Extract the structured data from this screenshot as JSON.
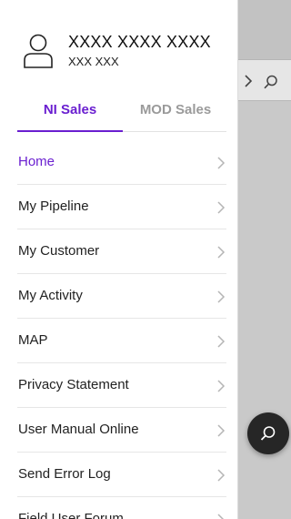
{
  "user": {
    "name": "XXXX XXXX XXXX",
    "id": "XXX XXX"
  },
  "tabs": [
    {
      "label": "NI Sales",
      "active": true
    },
    {
      "label": "MOD Sales",
      "active": false
    }
  ],
  "menu": [
    {
      "label": "Home",
      "active": true
    },
    {
      "label": "My Pipeline"
    },
    {
      "label": "My Customer"
    },
    {
      "label": "My Activity"
    },
    {
      "label": "MAP"
    },
    {
      "label": "Privacy Statement"
    },
    {
      "label": "User Manual Online"
    },
    {
      "label": "Send Error Log"
    },
    {
      "label": "Field User Forum"
    }
  ],
  "colors": {
    "accent": "#6a1fd0",
    "fab": "#262626",
    "overlay": "#c9c9c9"
  }
}
